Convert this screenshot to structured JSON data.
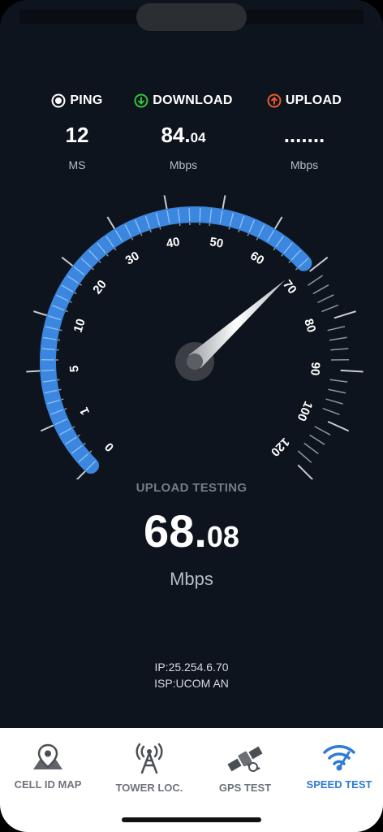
{
  "stats": {
    "ping": {
      "label": "PING",
      "value": "12",
      "unit": "MS"
    },
    "download": {
      "label": "DOWNLOAD",
      "value_int": "84.",
      "value_dec": "04",
      "unit": "Mbps"
    },
    "upload": {
      "label": "UPLOAD",
      "value": ".......",
      "unit": "Mbps"
    }
  },
  "gauge": {
    "labels": [
      "0",
      "1",
      "5",
      "10",
      "20",
      "30",
      "40",
      "50",
      "60",
      "70",
      "80",
      "90",
      "100",
      "120"
    ],
    "needle_value_label": "70",
    "current_mbps": 68.08,
    "accent": "#3b87df"
  },
  "result": {
    "status": "UPLOAD TESTING",
    "value_int": "68.",
    "value_dec": "08",
    "unit": "Mbps",
    "ip": "IP:25.254.6.70",
    "isp": "ISP:UCOM AN"
  },
  "tabs": [
    {
      "label": "CELL ID MAP",
      "icon": "map-pin-icon"
    },
    {
      "label": "TOWER LOC.",
      "icon": "tower-icon"
    },
    {
      "label": "GPS TEST",
      "icon": "satellite-icon"
    },
    {
      "label": "SPEED TEST",
      "icon": "wifi-icon",
      "active": true
    }
  ],
  "colors": {
    "background": "#0e141d",
    "accent": "#3b87df",
    "ping": "#ffffff",
    "download": "#36c23a",
    "upload": "#e85a2f",
    "tab_active": "#2f7bd6"
  }
}
